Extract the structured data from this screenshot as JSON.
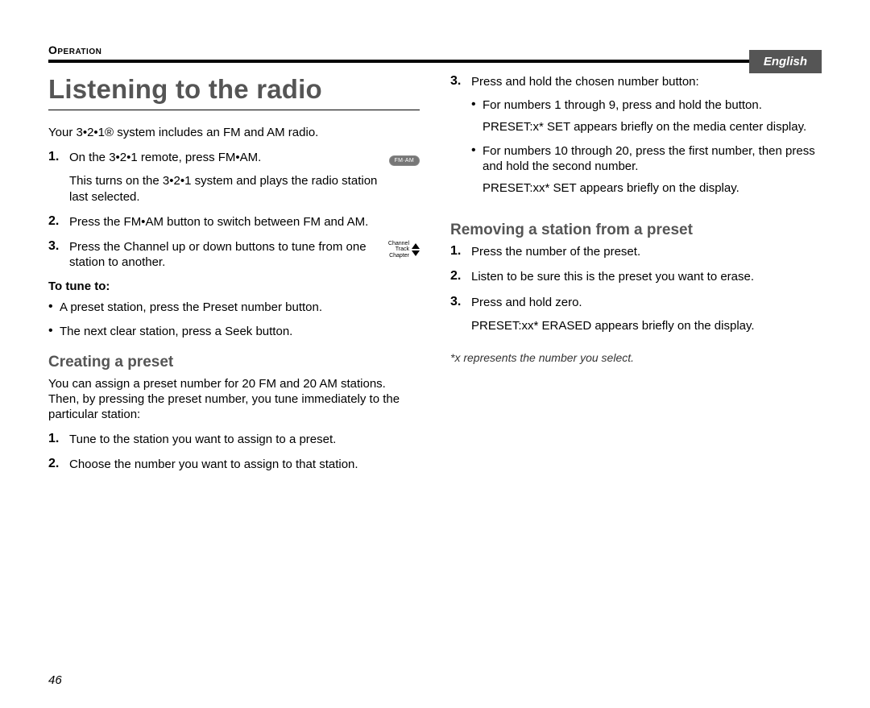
{
  "header": {
    "language_tab": "English",
    "section_label": "Operation"
  },
  "page_number": "46",
  "left": {
    "title": "Listening to the radio",
    "intro": "Your 3•2•1® system includes an FM and AM radio.",
    "steps": [
      {
        "num": "1.",
        "text": "On the 3•2•1 remote, press FM•AM.",
        "extra": "This turns on the 3•2•1 system and plays the radio station last selected.",
        "icon": "fmam"
      },
      {
        "num": "2.",
        "text": "Press the FM•AM button to switch between FM and AM."
      },
      {
        "num": "3.",
        "text": "Press the Channel up or down buttons to tune from one station to another.",
        "icon": "channel"
      }
    ],
    "to_tune_heading": "To tune to:",
    "to_tune_bullets": [
      "A preset station, press the Preset number button.",
      "The next clear station, press a Seek button."
    ],
    "creating": {
      "heading": "Creating a preset",
      "intro": "You can assign a preset number for 20 FM and 20 AM stations. Then, by pressing the preset number, you tune immediately to the particular station:",
      "steps": [
        {
          "num": "1.",
          "text": "Tune to the station you want to assign to a preset."
        },
        {
          "num": "2.",
          "text": "Choose the number you want to assign to that station."
        }
      ]
    }
  },
  "right": {
    "step3": {
      "num": "3.",
      "text": "Press and hold the chosen number button:",
      "bullets": [
        {
          "text": "For numbers 1 through 9, press and hold the button.",
          "after": "PRESET:x* SET appears briefly on the media center display."
        },
        {
          "text": "For numbers 10 through 20, press the first number, then press and hold the second number.",
          "after": "PRESET:xx* SET appears briefly on the display."
        }
      ]
    },
    "removing": {
      "heading": "Removing a station from a preset",
      "steps": [
        {
          "num": "1.",
          "text": "Press the number of the preset."
        },
        {
          "num": "2.",
          "text": "Listen to be sure this is the preset you want to erase."
        },
        {
          "num": "3.",
          "text": "Press and hold zero.",
          "extra": "PRESET:xx* ERASED appears briefly on the display."
        }
      ]
    },
    "footnote": "*x represents the number you select."
  },
  "icons": {
    "fmam_label": "FM·AM",
    "channel_labels": {
      "l1": "Channel",
      "l2": "Track",
      "l3": "Chapter"
    }
  }
}
